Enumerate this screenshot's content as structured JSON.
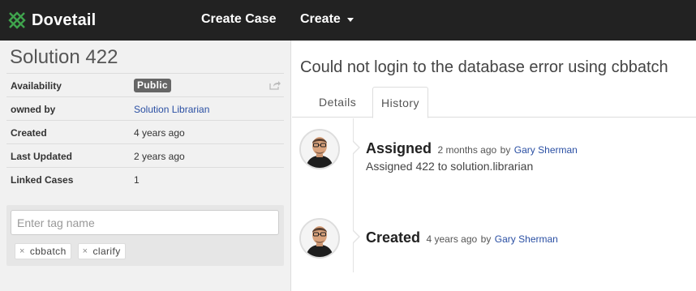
{
  "nav": {
    "brand": "Dovetail",
    "create_case": "Create Case",
    "create": "Create"
  },
  "solution": {
    "title": "Solution 422",
    "properties": [
      {
        "label": "Availability",
        "value": "Public"
      },
      {
        "label": "owned by",
        "value": "Solution Librarian"
      },
      {
        "label": "Created",
        "value": "4 years ago"
      },
      {
        "label": "Last Updated",
        "value": "2 years ago"
      },
      {
        "label": "Linked Cases",
        "value": "1"
      }
    ],
    "tag_input_placeholder": "Enter tag name",
    "tags": [
      "cbbatch",
      "clarify"
    ],
    "tag_remove_glyph": "×"
  },
  "case": {
    "title": "Could not login to the database error using cbbatch",
    "tabs": [
      "Details",
      "History"
    ],
    "active_tab": "History"
  },
  "history": [
    {
      "title": "Assigned",
      "time": "2 months ago",
      "by": "by",
      "user": "Gary Sherman",
      "description": "Assigned 422 to solution.librarian"
    },
    {
      "title": "Created",
      "time": "4 years ago",
      "by": "by",
      "user": "Gary Sherman",
      "description": ""
    }
  ],
  "colors": {
    "topbar": "#222222",
    "link": "#2a4fa3",
    "brand_green": "#3fa34d",
    "badge": "#666666"
  }
}
